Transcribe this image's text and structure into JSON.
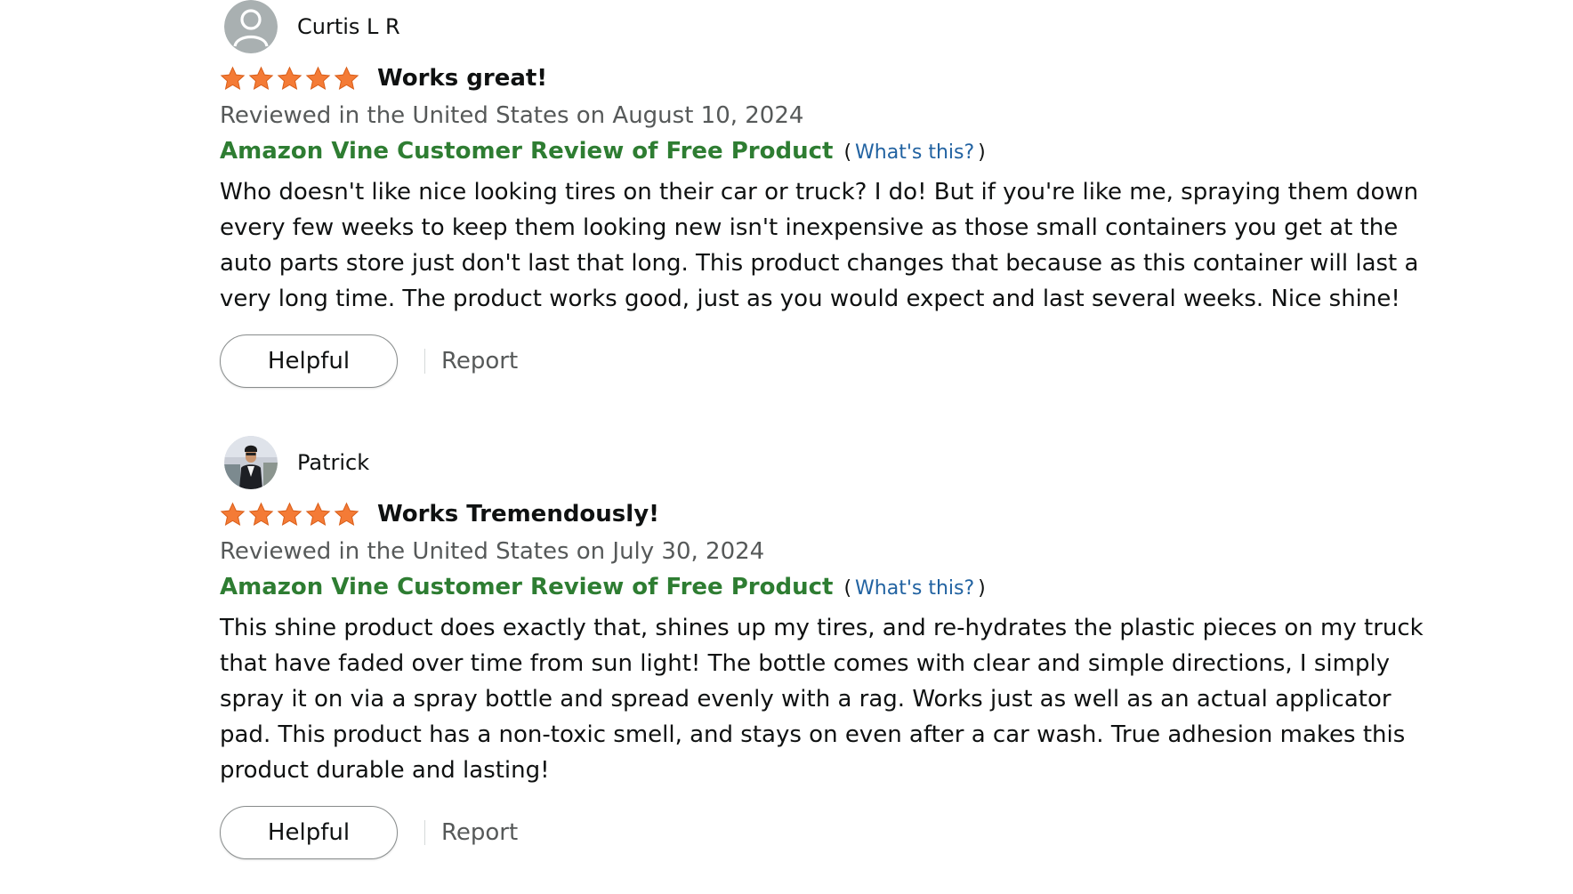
{
  "reviews": [
    {
      "reviewer": "Curtis L R",
      "avatar": "default-avatar-icon",
      "rating": 5,
      "rating_max": 5,
      "title": "Works great!",
      "date": "Reviewed in the United States on August 10, 2024",
      "vine_label": "Amazon Vine Customer Review of Free Product",
      "paren_open": "(",
      "whats_this": "What's this?",
      "paren_close": ")",
      "body": "Who doesn't like nice looking tires on their car or truck? I do! But if you're like me, spraying them down every few weeks to keep them looking new isn't inexpensive as those small containers you get at the auto parts store just don't last that long. This product changes that because as this container will last a very long time. The product works good, just as you would expect and last several weeks. Nice shine!",
      "helpful_label": "Helpful",
      "report_label": "Report"
    },
    {
      "reviewer": "Patrick",
      "avatar": "photo-avatar",
      "rating": 5,
      "rating_max": 5,
      "title": "Works Tremendously!",
      "date": "Reviewed in the United States on July 30, 2024",
      "vine_label": "Amazon Vine Customer Review of Free Product",
      "paren_open": "(",
      "whats_this": "What's this?",
      "paren_close": ")",
      "body": "This shine product does exactly that, shines up my tires, and re-hydrates the plastic pieces on my truck that have faded over time from sun light! The bottle comes with clear and simple directions, I simply spray it on via a spray bottle and spread evenly with a rag. Works just as well as an actual applicator pad. This product has a non-toxic smell, and stays on even after a car wash. True adhesion makes this product durable and lasting!",
      "helpful_label": "Helpful",
      "report_label": "Report"
    }
  ],
  "colors": {
    "star": "#f47b36",
    "vine": "#2e7d32",
    "link": "#2162a1",
    "muted": "#565959",
    "text": "#0f1111"
  }
}
